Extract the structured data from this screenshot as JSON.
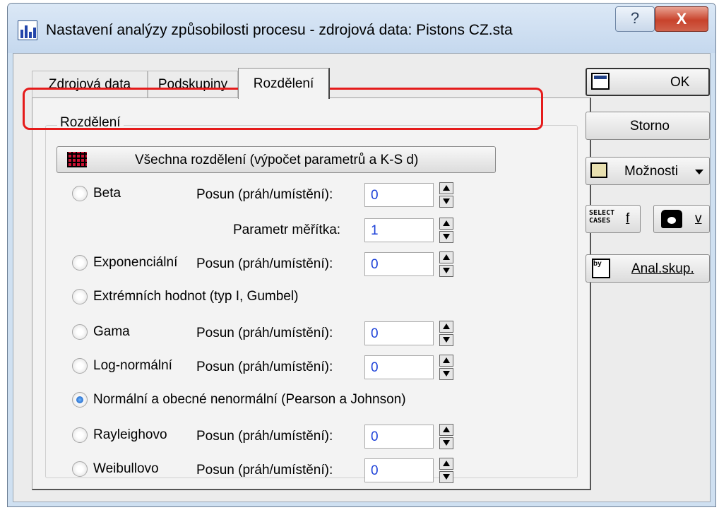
{
  "window": {
    "title": "Nastavení analýzy způsobilosti procesu - zdrojová data: Pistons CZ.sta",
    "help_glyph": "?",
    "close_glyph": "X"
  },
  "tabs": [
    {
      "label": "Zdrojová data",
      "active": false
    },
    {
      "label": "Podskupiny",
      "active": false
    },
    {
      "label": "Rozdělení",
      "active": true
    }
  ],
  "group": {
    "label": "Rozdělení"
  },
  "all_dist_button": {
    "label": "Všechna rozdělení (výpočet parametrů a K-S d)"
  },
  "distributions": [
    {
      "label": "Beta",
      "checked": false,
      "params": [
        {
          "label": "Posun (práh/umístění):",
          "value": "0"
        },
        {
          "label": "Parametr měřítka:",
          "value": "1"
        }
      ]
    },
    {
      "label": "Exponenciální",
      "checked": false,
      "params": [
        {
          "label": "Posun (práh/umístění):",
          "value": "0"
        }
      ]
    },
    {
      "label": "Extrémních hodnot (typ I, Gumbel)",
      "checked": false,
      "params": []
    },
    {
      "label": "Gama",
      "checked": false,
      "params": [
        {
          "label": "Posun (práh/umístění):",
          "value": "0"
        }
      ]
    },
    {
      "label": "Log-normální",
      "checked": false,
      "params": [
        {
          "label": "Posun (práh/umístění):",
          "value": "0"
        }
      ]
    },
    {
      "label": "Normální a obecné nenormální (Pearson a Johnson)",
      "checked": true,
      "params": []
    },
    {
      "label": "Rayleighovo",
      "checked": false,
      "params": [
        {
          "label": "Posun (práh/umístění):",
          "value": "0"
        }
      ]
    },
    {
      "label": "Weibullovo",
      "checked": false,
      "params": [
        {
          "label": "Posun (práh/umístění):",
          "value": "0"
        }
      ]
    }
  ],
  "side_buttons": {
    "ok": "OK",
    "storno": "Storno",
    "moznosti": "Možnosti",
    "select_cases_icon": "SELECT CASES",
    "select_letter": "f",
    "weight_letter": "v",
    "anal_skup": "Anal.skup.",
    "anal_icon_text": "by"
  },
  "colors": {
    "highlight": "#e51b1b",
    "field_value": "#1a3fd8"
  }
}
